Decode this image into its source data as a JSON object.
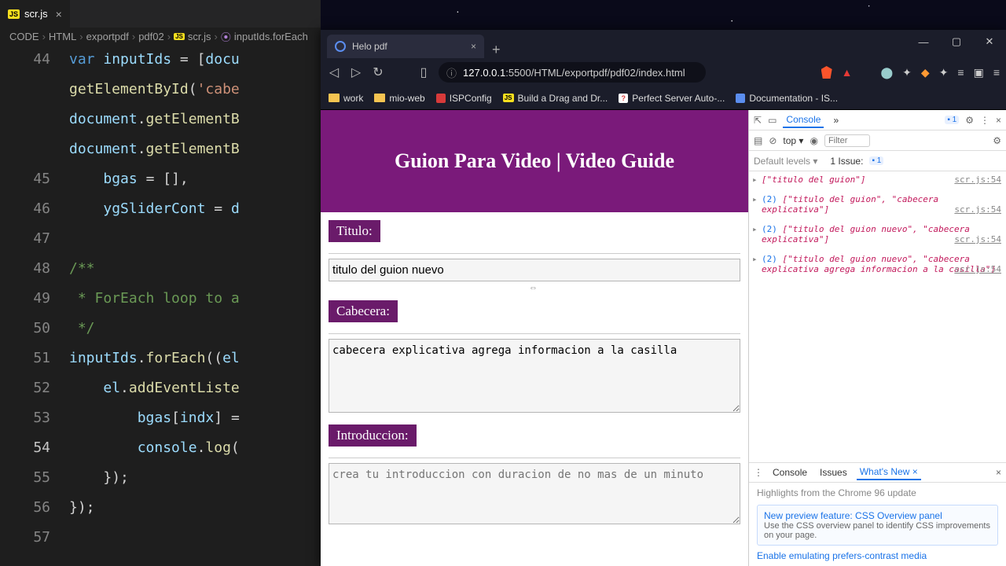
{
  "vscode": {
    "tab": {
      "filename": "scr.js"
    },
    "breadcrumb": [
      "CODE",
      "HTML",
      "exportpdf",
      "pdf02",
      "scr.js",
      "inputIds.forEach"
    ],
    "lines": {
      "44": "var inputIds = [docu",
      "44b": "getElementById('cabe",
      "44c": "document.getElementB",
      "44d": "document.getElementB",
      "45": "    bgas = [],",
      "46": "    ygSliderCont = d",
      "47": "",
      "48": "/**",
      "49": " * ForEach loop to a",
      "50": " */",
      "51": "inputIds.forEach((el",
      "52": "    el.addEventListe",
      "53": "        bgas[indx] =",
      "54": "        console.log(",
      "55": "    });",
      "56": "});",
      "57": ""
    }
  },
  "browser": {
    "tab_title": "Helo pdf",
    "url_host": "127.0.0.1",
    "url_port": ":5500",
    "url_path": "/HTML/exportpdf/pdf02/index.html",
    "bookmarks": [
      {
        "label": "work"
      },
      {
        "label": "mio-web"
      },
      {
        "label": "ISPConfig"
      },
      {
        "label": "Build a Drag and Dr..."
      },
      {
        "label": "Perfect Server Auto-..."
      },
      {
        "label": "Documentation - IS..."
      }
    ]
  },
  "page": {
    "header": "Guion Para Video | Video Guide",
    "titulo_label": "Titulo:",
    "titulo_value": "titulo del guion nuevo",
    "cabecera_label": "Cabecera:",
    "cabecera_value": "cabecera explicativa agrega informacion a la casilla",
    "intro_label": "Introduccion:",
    "intro_value": "crea tu introduccion con duracion de no mas de un minuto"
  },
  "devtools": {
    "tabs": {
      "console": "Console",
      "more": "»"
    },
    "issue_badge": "1",
    "context": "top ▾",
    "filter_ph": "Filter",
    "levels": "Default levels ▾",
    "issues": "1 Issue:",
    "issues_badge": "1",
    "logs": [
      {
        "text": "[\"titulo del guion\"]",
        "src": "scr.js:54"
      },
      {
        "count": "(2)",
        "text": "[\"titulo del guion\", \"cabecera explicativa\"]",
        "src": "scr.js:54"
      },
      {
        "count": "(2)",
        "text": "[\"titulo del guion nuevo\", \"cabecera explicativa\"]",
        "src": "scr.js:54"
      },
      {
        "count": "(2)",
        "text": "[\"titulo del guion nuevo\", \"cabecera explicativa agrega informacion a la casilla\"]",
        "src": "scr.js:54"
      }
    ],
    "bottom": {
      "console": "Console",
      "issues": "Issues",
      "whatsnew": "What's New"
    },
    "wn_highlight": "Highlights from the Chrome 96 update",
    "wn1_title": "New preview feature: CSS Overview panel",
    "wn1_desc": "Use the CSS overview panel to identify CSS improvements on your page.",
    "wn2": "Enable emulating prefers-contrast media"
  }
}
